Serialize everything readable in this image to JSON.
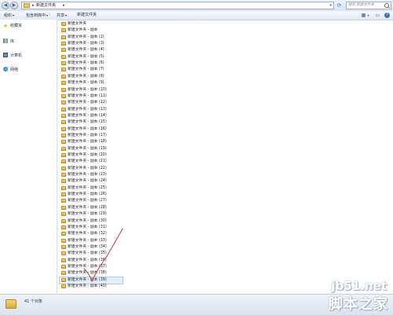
{
  "address_bar": {
    "crumb": "新建文件夹",
    "separator": "▸",
    "search_placeholder": "搜索 新建文件夹"
  },
  "toolbar": {
    "organize": "组织",
    "include_in_library": "包含到库中",
    "share": "共享",
    "new_folder": "新建文件夹",
    "caret": "▾"
  },
  "navigation": {
    "favorites": "收藏夹",
    "libraries": "库",
    "computer": "计算机",
    "network": "网络"
  },
  "files": [
    "新建文件夹",
    "新建文件夹 - 副本",
    "新建文件夹 - 副本 (2)",
    "新建文件夹 - 副本 (3)",
    "新建文件夹 - 副本 (4)",
    "新建文件夹 - 副本 (5)",
    "新建文件夹 - 副本 (6)",
    "新建文件夹 - 副本 (7)",
    "新建文件夹 - 副本 (8)",
    "新建文件夹 - 副本 (9)",
    "新建文件夹 - 副本 (10)",
    "新建文件夹 - 副本 (11)",
    "新建文件夹 - 副本 (12)",
    "新建文件夹 - 副本 (13)",
    "新建文件夹 - 副本 (14)",
    "新建文件夹 - 副本 (15)",
    "新建文件夹 - 副本 (16)",
    "新建文件夹 - 副本 (17)",
    "新建文件夹 - 副本 (18)",
    "新建文件夹 - 副本 (19)",
    "新建文件夹 - 副本 (20)",
    "新建文件夹 - 副本 (21)",
    "新建文件夹 - 副本 (22)",
    "新建文件夹 - 副本 (23)",
    "新建文件夹 - 副本 (24)",
    "新建文件夹 - 副本 (25)",
    "新建文件夹 - 副本 (26)",
    "新建文件夹 - 副本 (27)",
    "新建文件夹 - 副本 (28)",
    "新建文件夹 - 副本 (29)",
    "新建文件夹 - 副本 (30)",
    "新建文件夹 - 副本 (31)",
    "新建文件夹 - 副本 (32)",
    "新建文件夹 - 副本 (33)",
    "新建文件夹 - 副本 (34)",
    "新建文件夹 - 副本 (35)",
    "新建文件夹 - 副本 (36)",
    "新建文件夹 - 副本 (37)",
    "新建文件夹 - 副本 (38)",
    "新建文件夹 - 副本 (39)",
    "新建文件夹 - 副本 (40)"
  ],
  "selected_index": 39,
  "status": {
    "count": "41 个对象"
  },
  "watermark": {
    "url": "jb51.net",
    "name": "脚本之家"
  },
  "colors": {
    "annotation": "#c0392b",
    "selection": "#e3eefb"
  }
}
